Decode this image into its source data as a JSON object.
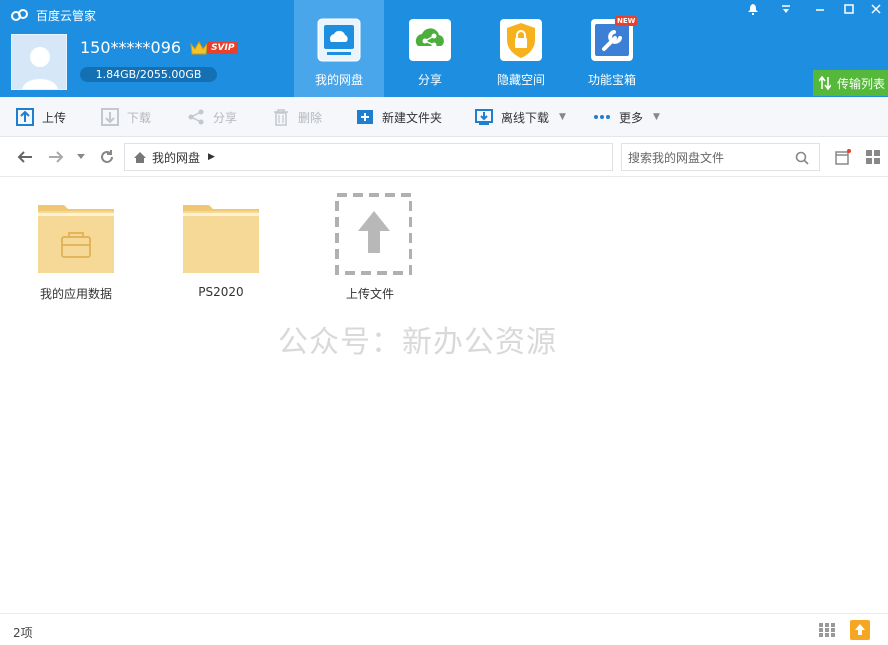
{
  "app": {
    "title": "百度云管家"
  },
  "user": {
    "name": "150*****096",
    "vip_badge": "SVIP",
    "quota": "1.84GB/2055.00GB"
  },
  "nav_tabs": [
    {
      "label": "我的网盘",
      "active": true
    },
    {
      "label": "分享",
      "active": false
    },
    {
      "label": "隐藏空间",
      "active": false
    },
    {
      "label": "功能宝箱",
      "active": false,
      "badge": "NEW"
    }
  ],
  "transfer": {
    "label": "传输列表"
  },
  "toolbar": {
    "upload": "上传",
    "download": "下载",
    "share": "分享",
    "delete": "删除",
    "new_folder": "新建文件夹",
    "offline_download": "离线下载",
    "more": "更多"
  },
  "address": {
    "breadcrumb": "我的网盘"
  },
  "search": {
    "placeholder": "搜索我的网盘文件"
  },
  "files": [
    {
      "name": "我的应用数据",
      "kind": "folder-app"
    },
    {
      "name": "PS2020",
      "kind": "folder"
    },
    {
      "name": "上传文件",
      "kind": "upload-placeholder"
    }
  ],
  "watermark": "公众号：新办公资源",
  "status": {
    "count": "2项"
  },
  "colors": {
    "header": "#1e8fe0",
    "active_tab": "#4aa6ea",
    "transfer": "#55b83b",
    "folder": "#f5d58f"
  }
}
